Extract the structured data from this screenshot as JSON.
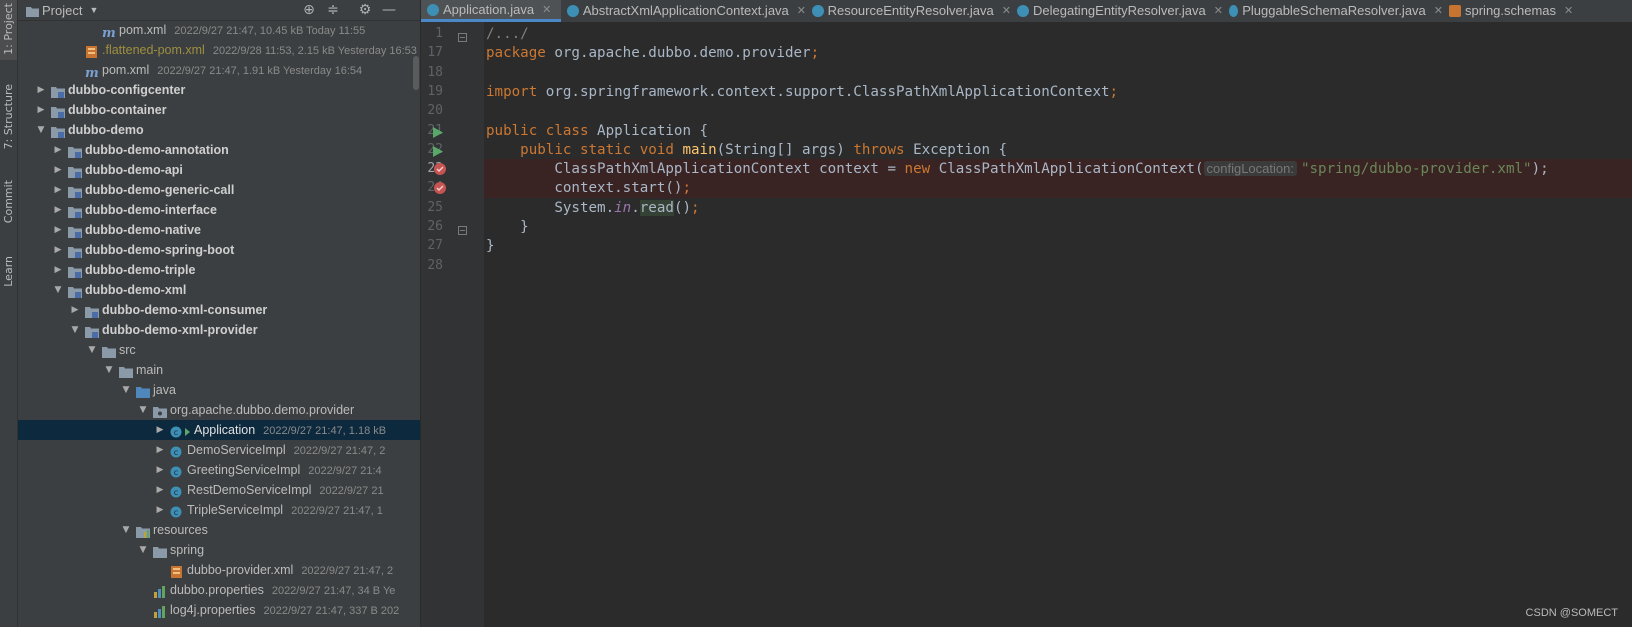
{
  "stripe": {
    "items": [
      {
        "label": "1: Project"
      },
      {
        "label": "7: Structure"
      },
      {
        "label": "Commit"
      },
      {
        "label": "Learn"
      }
    ]
  },
  "project": {
    "title": "Project",
    "tree": [
      {
        "indent": 4,
        "arrow": "",
        "icon": "maven",
        "label": "pom.xml",
        "meta": "2022/9/27 21:47, 10.45 kB Today 11:55",
        "style": "normal"
      },
      {
        "indent": 3,
        "arrow": "",
        "icon": "xml",
        "label": ".flattened-pom.xml",
        "meta": "2022/9/28 11:53, 2.15 kB Yesterday 16:53",
        "style": "yellow"
      },
      {
        "indent": 3,
        "arrow": "",
        "icon": "maven",
        "label": "pom.xml",
        "meta": "2022/9/27 21:47, 1.91 kB Yesterday 16:54",
        "style": "normal"
      },
      {
        "indent": 1,
        "arrow": "right",
        "icon": "module",
        "label": "dubbo-configcenter",
        "meta": "",
        "style": "bold"
      },
      {
        "indent": 1,
        "arrow": "right",
        "icon": "module",
        "label": "dubbo-container",
        "meta": "",
        "style": "bold"
      },
      {
        "indent": 1,
        "arrow": "down",
        "icon": "module",
        "label": "dubbo-demo",
        "meta": "",
        "style": "bold"
      },
      {
        "indent": 2,
        "arrow": "right",
        "icon": "module",
        "label": "dubbo-demo-annotation",
        "meta": "",
        "style": "bold"
      },
      {
        "indent": 2,
        "arrow": "right",
        "icon": "module",
        "label": "dubbo-demo-api",
        "meta": "",
        "style": "bold"
      },
      {
        "indent": 2,
        "arrow": "right",
        "icon": "module",
        "label": "dubbo-demo-generic-call",
        "meta": "",
        "style": "bold"
      },
      {
        "indent": 2,
        "arrow": "right",
        "icon": "module",
        "label": "dubbo-demo-interface",
        "meta": "",
        "style": "bold"
      },
      {
        "indent": 2,
        "arrow": "right",
        "icon": "module",
        "label": "dubbo-demo-native",
        "meta": "",
        "style": "bold"
      },
      {
        "indent": 2,
        "arrow": "right",
        "icon": "module",
        "label": "dubbo-demo-spring-boot",
        "meta": "",
        "style": "bold"
      },
      {
        "indent": 2,
        "arrow": "right",
        "icon": "module",
        "label": "dubbo-demo-triple",
        "meta": "",
        "style": "bold"
      },
      {
        "indent": 2,
        "arrow": "down",
        "icon": "module",
        "label": "dubbo-demo-xml",
        "meta": "",
        "style": "bold"
      },
      {
        "indent": 3,
        "arrow": "right",
        "icon": "module",
        "label": "dubbo-demo-xml-consumer",
        "meta": "",
        "style": "bold"
      },
      {
        "indent": 3,
        "arrow": "down",
        "icon": "module",
        "label": "dubbo-demo-xml-provider",
        "meta": "",
        "style": "bold"
      },
      {
        "indent": 4,
        "arrow": "down",
        "icon": "folder",
        "label": "src",
        "meta": "",
        "style": "normal"
      },
      {
        "indent": 5,
        "arrow": "down",
        "icon": "folder",
        "label": "main",
        "meta": "",
        "style": "normal"
      },
      {
        "indent": 6,
        "arrow": "down",
        "icon": "folder-blue",
        "label": "java",
        "meta": "",
        "style": "normal"
      },
      {
        "indent": 7,
        "arrow": "down",
        "icon": "package",
        "label": "org.apache.dubbo.demo.provider",
        "meta": "",
        "style": "normal"
      },
      {
        "indent": 8,
        "arrow": "right",
        "icon": "class-run",
        "label": "Application",
        "meta": "2022/9/27 21:47, 1.18 kB",
        "style": "normal",
        "selected": true
      },
      {
        "indent": 8,
        "arrow": "right",
        "icon": "class",
        "label": "DemoServiceImpl",
        "meta": "2022/9/27 21:47, 2",
        "style": "normal"
      },
      {
        "indent": 8,
        "arrow": "right",
        "icon": "class",
        "label": "GreetingServiceImpl",
        "meta": "2022/9/27 21:4",
        "style": "normal"
      },
      {
        "indent": 8,
        "arrow": "right",
        "icon": "class",
        "label": "RestDemoServiceImpl",
        "meta": "2022/9/27 21",
        "style": "normal"
      },
      {
        "indent": 8,
        "arrow": "right",
        "icon": "class",
        "label": "TripleServiceImpl",
        "meta": "2022/9/27 21:47, 1",
        "style": "normal"
      },
      {
        "indent": 6,
        "arrow": "down",
        "icon": "folder-res",
        "label": "resources",
        "meta": "",
        "style": "normal"
      },
      {
        "indent": 7,
        "arrow": "down",
        "icon": "folder",
        "label": "spring",
        "meta": "",
        "style": "normal"
      },
      {
        "indent": 8,
        "arrow": "",
        "icon": "xml",
        "label": "dubbo-provider.xml",
        "meta": "2022/9/27 21:47, 2",
        "style": "normal"
      },
      {
        "indent": 7,
        "arrow": "",
        "icon": "props",
        "label": "dubbo.properties",
        "meta": "2022/9/27 21:47, 34 B Ye",
        "style": "normal"
      },
      {
        "indent": 7,
        "arrow": "",
        "icon": "props",
        "label": "log4j.properties",
        "meta": "2022/9/27 21:47, 337 B 202",
        "style": "normal"
      }
    ]
  },
  "tabs": [
    {
      "label": "Application.java",
      "icon": "class",
      "active": true
    },
    {
      "label": "AbstractXmlApplicationContext.java",
      "icon": "class",
      "active": false
    },
    {
      "label": "ResourceEntityResolver.java",
      "icon": "class",
      "active": false
    },
    {
      "label": "DelegatingEntityResolver.java",
      "icon": "class",
      "active": false
    },
    {
      "label": "PluggableSchemaResolver.java",
      "icon": "class",
      "active": false
    },
    {
      "label": "spring.schemas",
      "icon": "xml",
      "active": false
    }
  ],
  "editor": {
    "lines": [
      {
        "num": "1",
        "gutter": "fold",
        "bp": false,
        "tokens": [
          [
            "cmt",
            "/.../"
          ]
        ]
      },
      {
        "num": "17",
        "gutter": "",
        "bp": false,
        "tokens": [
          [
            "kw",
            "package "
          ],
          [
            "",
            "org.apache.dubbo.demo.provider"
          ],
          [
            "kw",
            ";"
          ]
        ]
      },
      {
        "num": "18",
        "gutter": "",
        "bp": false,
        "tokens": []
      },
      {
        "num": "19",
        "gutter": "",
        "bp": false,
        "tokens": [
          [
            "kw",
            "import "
          ],
          [
            "",
            "org.springframework.context.support.ClassPathXmlApplicationContext"
          ],
          [
            "kw",
            ";"
          ]
        ]
      },
      {
        "num": "20",
        "gutter": "",
        "bp": false,
        "tokens": []
      },
      {
        "num": "21",
        "gutter": "run",
        "bp": false,
        "tokens": [
          [
            "kw",
            "public class "
          ],
          [
            "",
            "Application {"
          ]
        ]
      },
      {
        "num": "22",
        "gutter": "run",
        "bp": false,
        "tokens": [
          [
            "",
            "    "
          ],
          [
            "kw",
            "public static void "
          ],
          [
            "fn",
            "main"
          ],
          [
            "",
            "(String[] args) "
          ],
          [
            "kw",
            "throws "
          ],
          [
            "",
            "Exception {"
          ]
        ]
      },
      {
        "num": "23",
        "gutter": "breakpoint",
        "bp": true,
        "tokens": [
          [
            "",
            "        ClassPathXmlApplicationContext context = "
          ],
          [
            "kw",
            "new "
          ],
          [
            "",
            "ClassPathXmlApplicationContext("
          ],
          [
            "hint",
            "configLocation:"
          ],
          [
            "str",
            "\"spring/dubbo-provider.xml\""
          ],
          [
            "",
            "); "
          ]
        ]
      },
      {
        "num": "24",
        "gutter": "breakpoint",
        "bp": true,
        "tokens": [
          [
            "",
            "        context.start()"
          ],
          [
            "kw",
            ";"
          ]
        ]
      },
      {
        "num": "25",
        "gutter": "",
        "bp": false,
        "tokens": [
          [
            "",
            "        System."
          ],
          [
            "fld",
            "in"
          ],
          [
            "",
            "."
          ],
          [
            "readhl",
            "read"
          ],
          [
            "",
            "()"
          ],
          [
            "kw",
            ";"
          ]
        ]
      },
      {
        "num": "26",
        "gutter": "fold",
        "bp": false,
        "tokens": [
          [
            "",
            "    }"
          ]
        ]
      },
      {
        "num": "27",
        "gutter": "",
        "bp": false,
        "tokens": [
          [
            "",
            "}"
          ]
        ]
      },
      {
        "num": "28",
        "gutter": "",
        "bp": false,
        "tokens": []
      }
    ],
    "current_line": "23"
  },
  "watermark": "CSDN @SOMECT"
}
